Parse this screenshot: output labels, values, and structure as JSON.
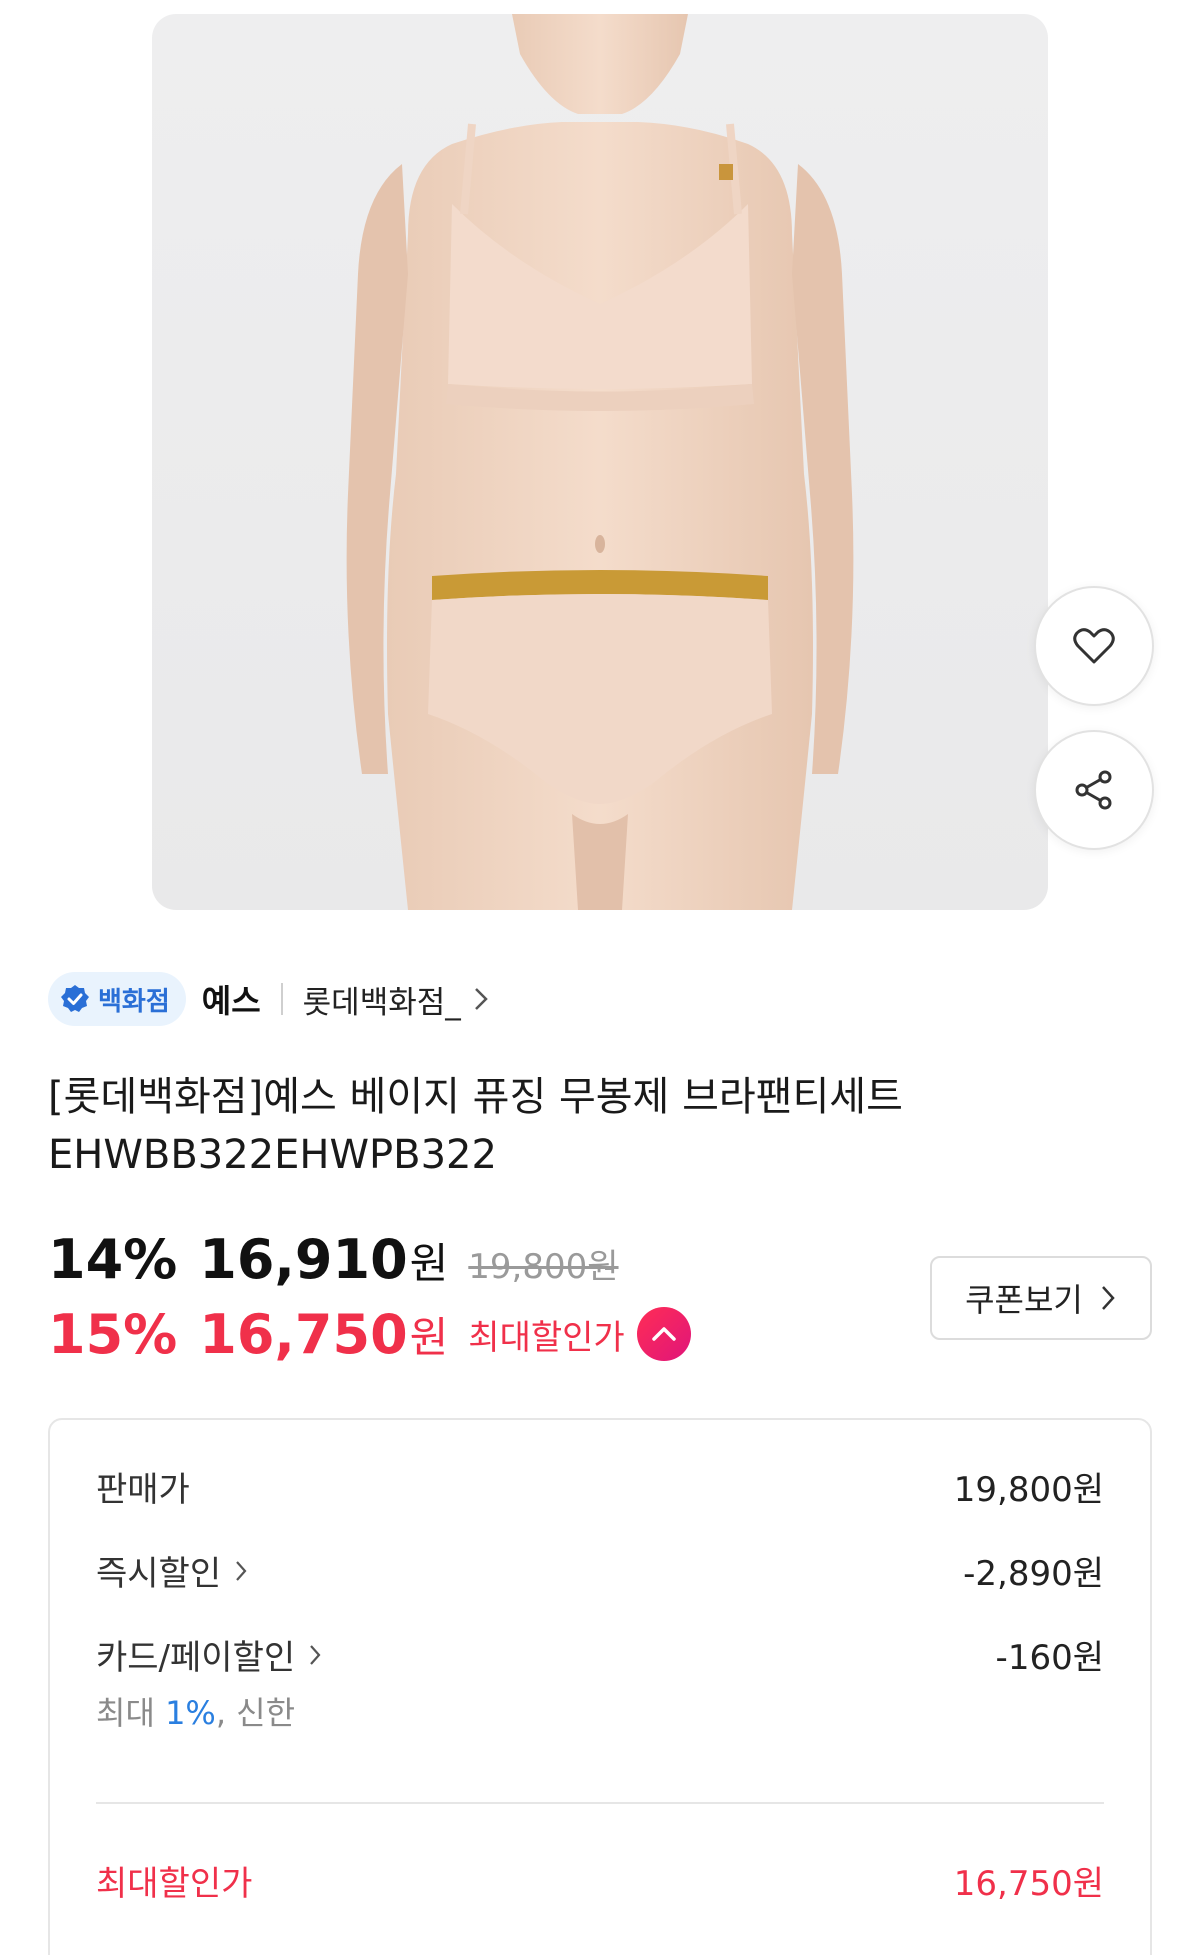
{
  "product": {
    "image_alt": "product photo",
    "wish_icon": "heart-icon",
    "share_icon": "share-icon"
  },
  "seller": {
    "badge_label": "백화점",
    "brand": "예스",
    "store": "롯데백화점_"
  },
  "title_lines": [
    "[롯데백화점]예스 베이지 퓨징 무봉제 브라팬티세트",
    "EHWBB322EHWPB322"
  ],
  "price": {
    "discount_pct": "14%",
    "sale_amount": "16,910",
    "won": "원",
    "original": "19,800원",
    "max_pct": "15%",
    "max_amount": "16,750",
    "max_label": "최대할인가"
  },
  "coupon": {
    "label": "쿠폰보기"
  },
  "breakdown": {
    "rows": [
      {
        "label": "판매가",
        "value": "19,800원"
      },
      {
        "label": "즉시할인",
        "value": "-2,890원"
      },
      {
        "label": "카드/페이할인",
        "value": "-160원"
      }
    ],
    "card_note": {
      "prefix": "최대 ",
      "pct": "1%",
      "suffix": ", 신한"
    },
    "total": {
      "label": "최대할인가",
      "value": "16,750원"
    }
  },
  "colors": {
    "accent_red": "#f0304a",
    "badge_blue": "#2a6fd6",
    "link_blue": "#2a7fe0"
  }
}
